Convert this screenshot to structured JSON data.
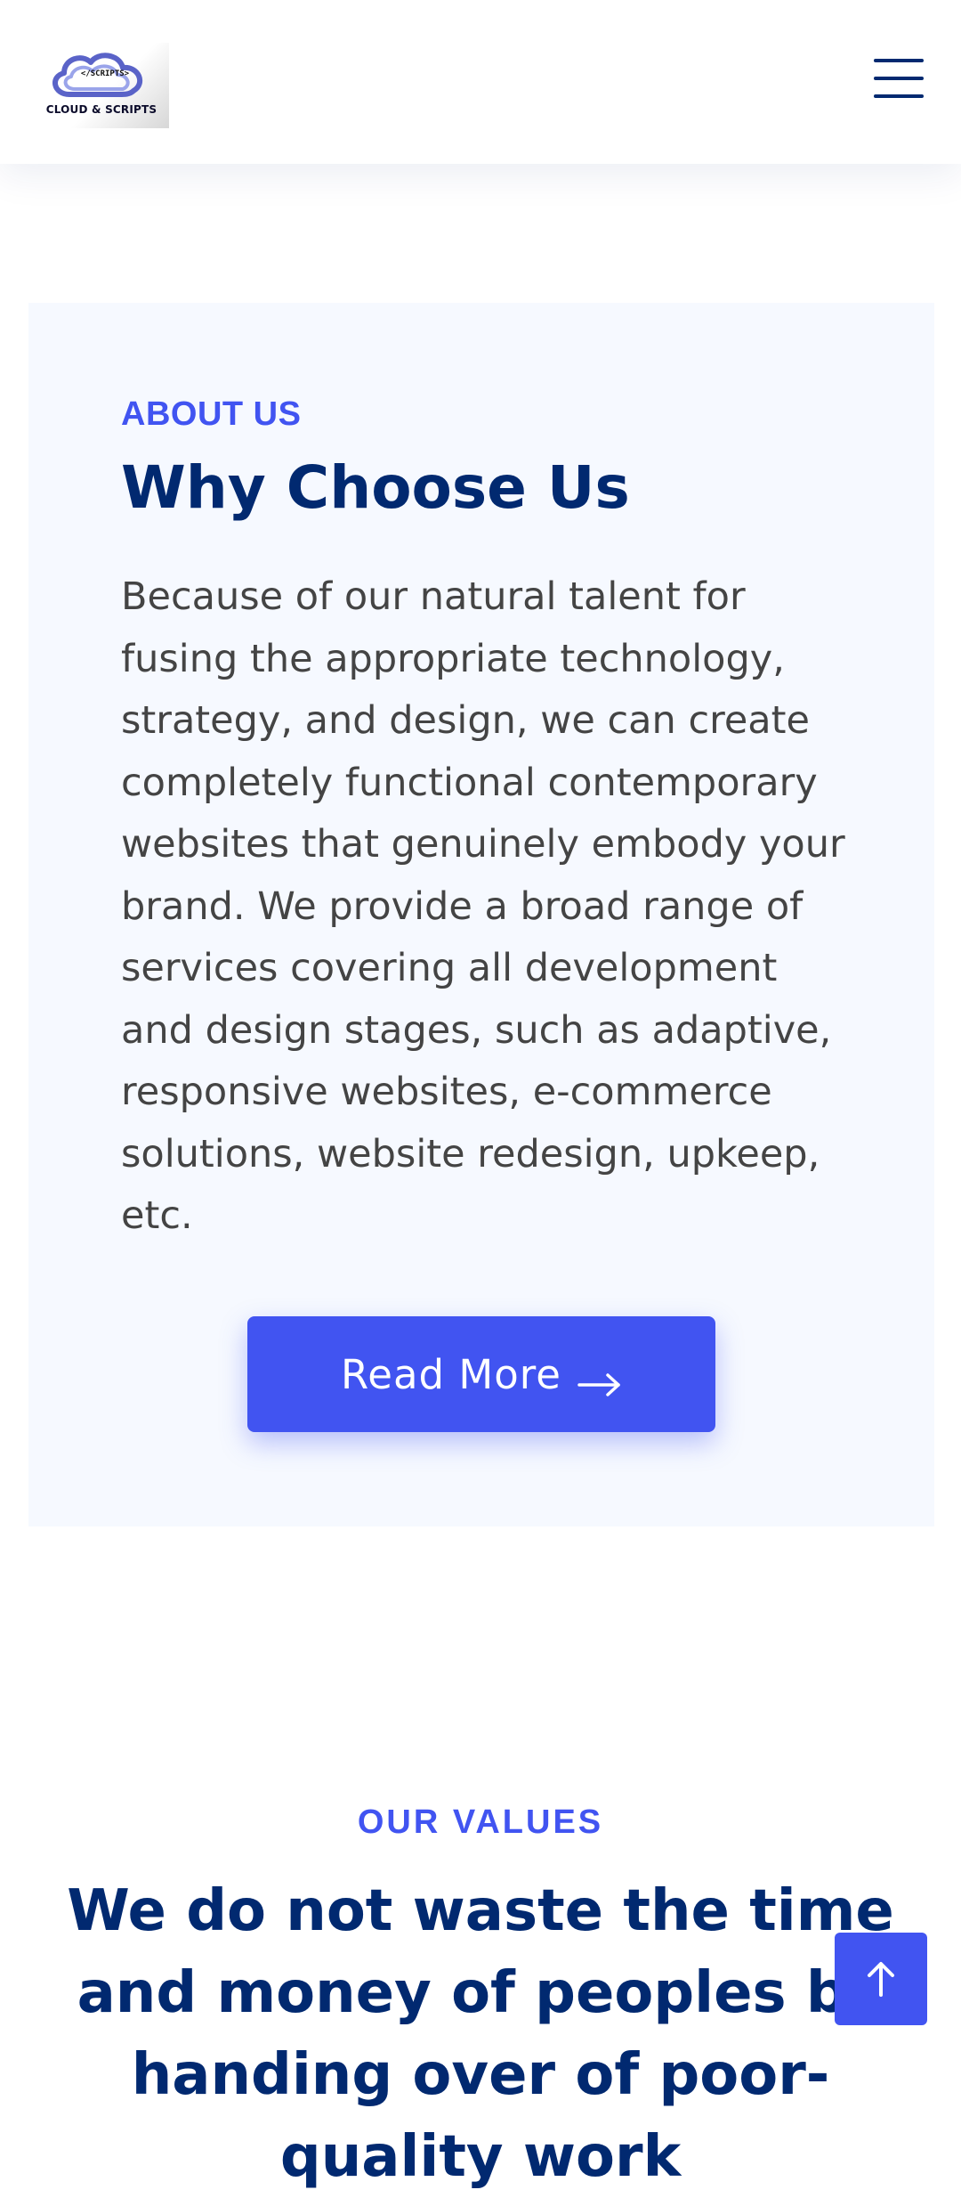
{
  "header": {
    "logo": {
      "text": "CLOUD & SCRIPTS",
      "tag": "</SCRIPTS>"
    },
    "menu_icon": "hamburger-icon"
  },
  "about": {
    "eyebrow": "ABOUT US",
    "title": "Why Choose Us",
    "text": "Because of our natural talent for fusing the appropriate technology, strategy, and design, we can create completely functional contemporary websites that genuinely embody your brand. We provide a broad range of services covering all development and design stages, such as adaptive, responsive websites, e-commerce solutions, website redesign, upkeep, etc.",
    "button_label": "Read More",
    "button_icon": "arrow-right-icon"
  },
  "values": {
    "eyebrow": "OUR VALUES",
    "title": "We do not waste the time and money of peoples by handing over of poor-quality work"
  },
  "back_to_top": {
    "icon": "arrow-up-icon"
  },
  "colors": {
    "accent": "#4154f1",
    "heading": "#012970",
    "body_text": "#444444",
    "card_background": "#f6f9ff"
  }
}
